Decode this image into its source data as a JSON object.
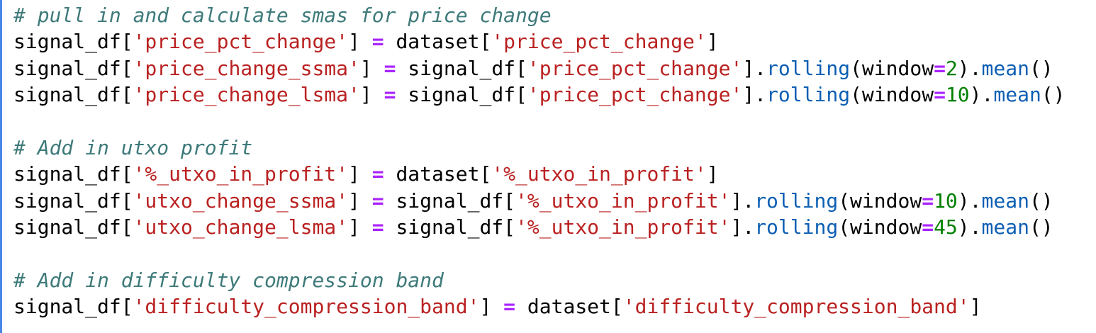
{
  "lines": [
    {
      "tokens": [
        {
          "t": "# pull in and calculate smas for price change",
          "c": "comment"
        }
      ]
    },
    {
      "tokens": [
        {
          "t": "signal_df[",
          "c": "plain"
        },
        {
          "t": "'price_pct_change'",
          "c": "str"
        },
        {
          "t": "] ",
          "c": "plain"
        },
        {
          "t": "=",
          "c": "op"
        },
        {
          "t": " dataset[",
          "c": "plain"
        },
        {
          "t": "'price_pct_change'",
          "c": "str"
        },
        {
          "t": "]",
          "c": "plain"
        }
      ]
    },
    {
      "tokens": [
        {
          "t": "signal_df[",
          "c": "plain"
        },
        {
          "t": "'price_change_ssma'",
          "c": "str"
        },
        {
          "t": "] ",
          "c": "plain"
        },
        {
          "t": "=",
          "c": "op"
        },
        {
          "t": " signal_df[",
          "c": "plain"
        },
        {
          "t": "'price_pct_change'",
          "c": "str"
        },
        {
          "t": "].",
          "c": "plain"
        },
        {
          "t": "rolling",
          "c": "fn"
        },
        {
          "t": "(window",
          "c": "plain"
        },
        {
          "t": "=",
          "c": "op"
        },
        {
          "t": "2",
          "c": "num"
        },
        {
          "t": ").",
          "c": "plain"
        },
        {
          "t": "mean",
          "c": "fn"
        },
        {
          "t": "()",
          "c": "plain"
        }
      ]
    },
    {
      "tokens": [
        {
          "t": "signal_df[",
          "c": "plain"
        },
        {
          "t": "'price_change_lsma'",
          "c": "str"
        },
        {
          "t": "] ",
          "c": "plain"
        },
        {
          "t": "=",
          "c": "op"
        },
        {
          "t": " signal_df[",
          "c": "plain"
        },
        {
          "t": "'price_pct_change'",
          "c": "str"
        },
        {
          "t": "].",
          "c": "plain"
        },
        {
          "t": "rolling",
          "c": "fn"
        },
        {
          "t": "(window",
          "c": "plain"
        },
        {
          "t": "=",
          "c": "op"
        },
        {
          "t": "10",
          "c": "num"
        },
        {
          "t": ").",
          "c": "plain"
        },
        {
          "t": "mean",
          "c": "fn"
        },
        {
          "t": "()",
          "c": "plain"
        }
      ]
    },
    {
      "tokens": []
    },
    {
      "tokens": [
        {
          "t": "# Add in utxo profit",
          "c": "comment"
        }
      ]
    },
    {
      "tokens": [
        {
          "t": "signal_df[",
          "c": "plain"
        },
        {
          "t": "'%_utxo_in_profit'",
          "c": "str"
        },
        {
          "t": "] ",
          "c": "plain"
        },
        {
          "t": "=",
          "c": "op"
        },
        {
          "t": " dataset[",
          "c": "plain"
        },
        {
          "t": "'%_utxo_in_profit'",
          "c": "str"
        },
        {
          "t": "]",
          "c": "plain"
        }
      ]
    },
    {
      "tokens": [
        {
          "t": "signal_df[",
          "c": "plain"
        },
        {
          "t": "'utxo_change_ssma'",
          "c": "str"
        },
        {
          "t": "] ",
          "c": "plain"
        },
        {
          "t": "=",
          "c": "op"
        },
        {
          "t": " signal_df[",
          "c": "plain"
        },
        {
          "t": "'%_utxo_in_profit'",
          "c": "str"
        },
        {
          "t": "].",
          "c": "plain"
        },
        {
          "t": "rolling",
          "c": "fn"
        },
        {
          "t": "(window",
          "c": "plain"
        },
        {
          "t": "=",
          "c": "op"
        },
        {
          "t": "10",
          "c": "num"
        },
        {
          "t": ").",
          "c": "plain"
        },
        {
          "t": "mean",
          "c": "fn"
        },
        {
          "t": "()",
          "c": "plain"
        }
      ]
    },
    {
      "tokens": [
        {
          "t": "signal_df[",
          "c": "plain"
        },
        {
          "t": "'utxo_change_lsma'",
          "c": "str"
        },
        {
          "t": "] ",
          "c": "plain"
        },
        {
          "t": "=",
          "c": "op"
        },
        {
          "t": " signal_df[",
          "c": "plain"
        },
        {
          "t": "'%_utxo_in_profit'",
          "c": "str"
        },
        {
          "t": "].",
          "c": "plain"
        },
        {
          "t": "rolling",
          "c": "fn"
        },
        {
          "t": "(window",
          "c": "plain"
        },
        {
          "t": "=",
          "c": "op"
        },
        {
          "t": "45",
          "c": "num"
        },
        {
          "t": ").",
          "c": "plain"
        },
        {
          "t": "mean",
          "c": "fn"
        },
        {
          "t": "()",
          "c": "plain"
        }
      ]
    },
    {
      "tokens": []
    },
    {
      "tokens": [
        {
          "t": "# Add in difficulty compression band",
          "c": "comment"
        }
      ]
    },
    {
      "tokens": [
        {
          "t": "signal_df[",
          "c": "plain"
        },
        {
          "t": "'difficulty_compression_band'",
          "c": "str"
        },
        {
          "t": "] ",
          "c": "plain"
        },
        {
          "t": "=",
          "c": "op"
        },
        {
          "t": " dataset[",
          "c": "plain"
        },
        {
          "t": "'difficulty_compression_band'",
          "c": "str"
        },
        {
          "t": "]",
          "c": "plain"
        }
      ]
    }
  ]
}
